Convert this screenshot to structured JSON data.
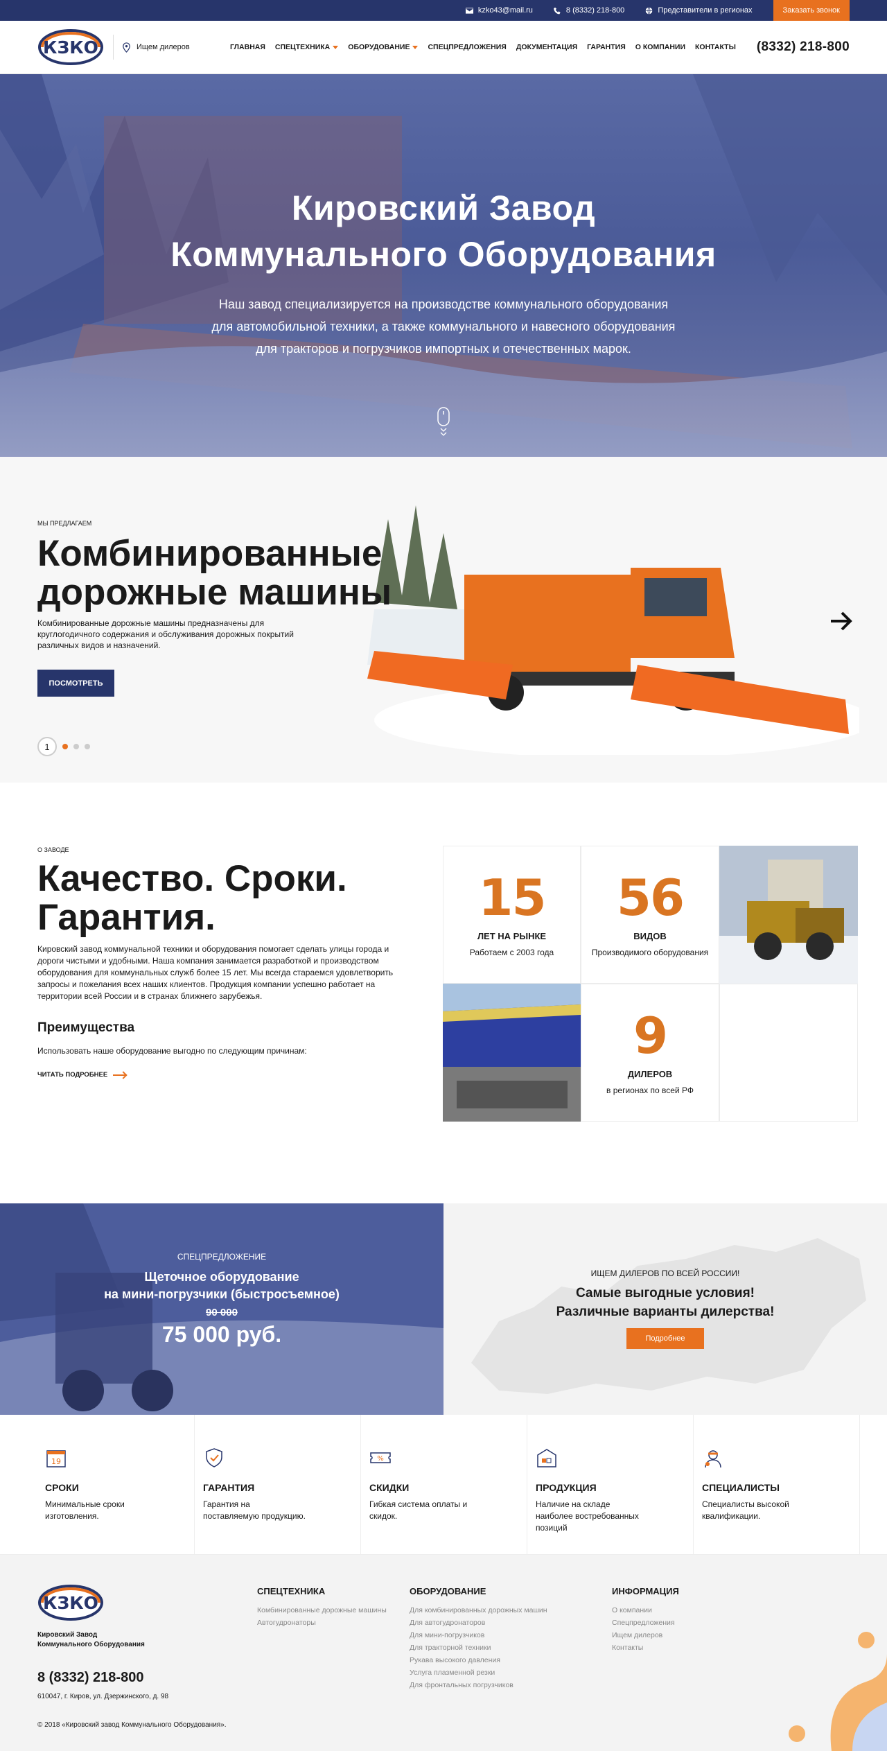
{
  "topbar": {
    "email": "kzko43@mail.ru",
    "phone": "8 (8332) 218-800",
    "regions": "Представители в регионах",
    "callback": "Заказать звонок"
  },
  "header": {
    "logo_text": "КЗКО",
    "dealer": "Ищем дилеров",
    "nav": [
      "Главная",
      "Спецтехника",
      "Оборудование",
      "Спецпредложения",
      "Документация",
      "Гарантия",
      "О компании",
      "Контакты"
    ],
    "phone": "(8332) 218-800"
  },
  "hero": {
    "title_line1": "Кировский Завод",
    "title_line2": "Коммунального Оборудования",
    "text_line1": "Наш завод специализируется на производстве коммунального оборудования",
    "text_line2": "для автомобильной техники, а также коммунального и навесного оборудования",
    "text_line3": "для тракторов и погрузчиков импортных и отечественных марок."
  },
  "slider": {
    "eyebrow": "Мы предлагаем",
    "title": "Комбинированные дорожные машины",
    "desc": "Комбинированные дорожные машины предназначены для круглогодичного содержания и обслуживания дорожных покрытий различных видов и назначений.",
    "button": "Посмотреть",
    "page": "1",
    "dots": 3,
    "active_dot": 1
  },
  "about": {
    "eyebrow": "О заводе",
    "title": "Качество. Сроки. Гарантия.",
    "text": "Кировский завод коммунальной техники и оборудования помогает сделать улицы города и дороги чистыми и удобными. Наша компания занимается разработкой и производством оборудования для коммунальных служб более 15 лет. Мы всегда стараемся удовлетворить запросы и пожелания всех наших клиентов. Продукция компании успешно работает на территории всей России и в странах ближнего зарубежья.",
    "adv_title": "Преимущества",
    "adv_text": "Использовать наше оборудование выгодно по следующим причинам:",
    "more": "Читать подробнее",
    "stats": [
      {
        "num": "15",
        "label": "Лет на рынке",
        "sub": "Работаем с 2003 года"
      },
      {
        "num": "56",
        "label": "Видов",
        "sub": "Производимого оборудования"
      },
      {
        "num": "9",
        "label": "Дилеров",
        "sub": "в регионах по всей РФ"
      }
    ]
  },
  "promo": {
    "eyebrow": "Спецпредложение",
    "title_line1": "Щеточное оборудование",
    "title_line2": "на мини-погрузчики (быстросъемное)",
    "old_price": "90 000",
    "new_price": "75 000 руб.",
    "dealers_eyebrow": "ИЩЕМ ДИЛЕРОВ ПО ВСЕЙ РОССИИ!",
    "dealers_line1": "Самые выгодные условия!",
    "dealers_line2": "Различные варианты дилерства!",
    "dealers_button": "Подробнее"
  },
  "features": [
    {
      "icon": "calendar-icon",
      "title": "Сроки",
      "desc": "Минимальные сроки изготовления."
    },
    {
      "icon": "shield-check-icon",
      "title": "Гарантия",
      "desc": "Гарантия на поставляемую продукцию."
    },
    {
      "icon": "discount-ticket-icon",
      "title": "Скидки",
      "desc": "Гибкая система оплаты и скидок."
    },
    {
      "icon": "warehouse-icon",
      "title": "Продукция",
      "desc": "Наличие на складе наиболее востребованных позиций"
    },
    {
      "icon": "worker-icon",
      "title": "Специалисты",
      "desc": "Специалисты высокой квалификации."
    }
  ],
  "footer": {
    "name_line1": "Кировский Завод",
    "name_line2": "Коммунального Оборудования",
    "phone": "8 (8332) 218-800",
    "address": "610047, г. Киров, ул. Дзержинского, д. 98",
    "copyright": "© 2018 «Кировский завод Коммунального Оборудования».",
    "col1": {
      "title": "Спецтехника",
      "links": [
        "Комбинированные дорожные машины",
        "Автогудронаторы"
      ]
    },
    "col2": {
      "title": "Оборудование",
      "links": [
        "Для комбинированных дорожных машин",
        "Для автогудронаторов",
        "Для мини-погрузчиков",
        "Для тракторной техники",
        "Рукава высокого давления",
        "Услуга плазменной резки",
        "Для фронтальных погрузчиков"
      ]
    },
    "col3": {
      "title": "Информация",
      "links": [
        "О компании",
        "Спецпредложения",
        "Ищем дилеров",
        "Контакты"
      ]
    }
  },
  "colors": {
    "navy": "#27356b",
    "orange": "#e8711f",
    "stat_orange": "#d97522"
  }
}
